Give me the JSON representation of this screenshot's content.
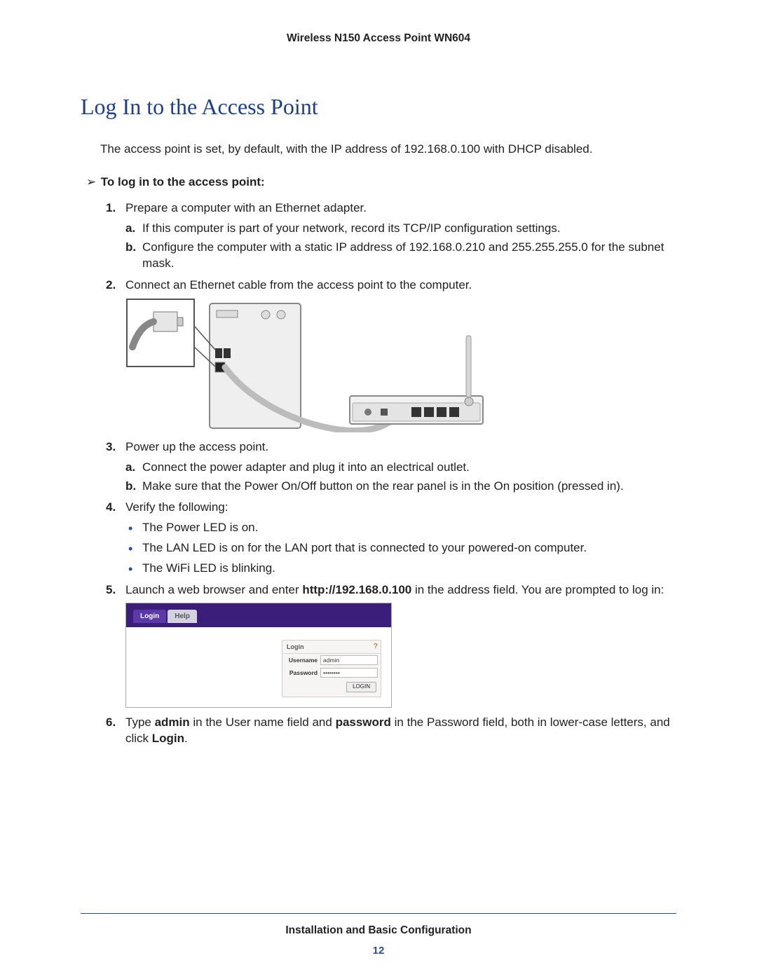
{
  "header": {
    "product": "Wireless N150 Access Point WN604"
  },
  "section": {
    "title": "Log In to the Access Point"
  },
  "intro": "The access point is set, by default, with the IP address of 192.168.0.100 with DHCP disabled.",
  "procedure": {
    "arrow": "➢",
    "label": "To log in to the access point:"
  },
  "steps": {
    "s1": {
      "num": "1.",
      "text": "Prepare a computer with an Ethernet adapter.",
      "a": {
        "let": "a.",
        "text": "If this computer is part of your network, record its TCP/IP configuration settings."
      },
      "b": {
        "let": "b.",
        "text": "Configure the computer with a static IP address of 192.168.0.210 and 255.255.255.0 for the subnet mask."
      }
    },
    "s2": {
      "num": "2.",
      "text": "Connect an Ethernet cable from the access point to the computer."
    },
    "s3": {
      "num": "3.",
      "text": "Power up the access point.",
      "a": {
        "let": "a.",
        "text": "Connect the power adapter and plug it into an electrical outlet."
      },
      "b": {
        "let": "b.",
        "text": "Make sure that the Power On/Off button on the rear panel is in the On position (pressed in)."
      }
    },
    "s4": {
      "num": "4.",
      "text": "Verify the following:",
      "b1": "The Power LED is on.",
      "b2": "The LAN LED is on for the LAN port that is connected to your powered-on computer.",
      "b3": "The WiFi LED is blinking."
    },
    "s5": {
      "num": "5.",
      "pre": "Launch a web browser and enter ",
      "url": "http://192.168.0.100",
      "post": " in the address field. You are prompted to log in:"
    },
    "s6": {
      "num": "6.",
      "t1": "Type ",
      "admin": "admin",
      "t2": " in the User name field and ",
      "password": "password",
      "t3": " in the Password field, both in lower-case letters, and click ",
      "login": "Login",
      "t4": "."
    }
  },
  "login_ui": {
    "tab_login": "Login",
    "tab_help": "Help",
    "panel_title": "Login",
    "username_label": "Username",
    "username_value": "admin",
    "password_label": "Password",
    "password_value": "••••••••",
    "button": "LOGIN"
  },
  "footer": {
    "chapter": "Installation and Basic Configuration",
    "page": "12"
  }
}
